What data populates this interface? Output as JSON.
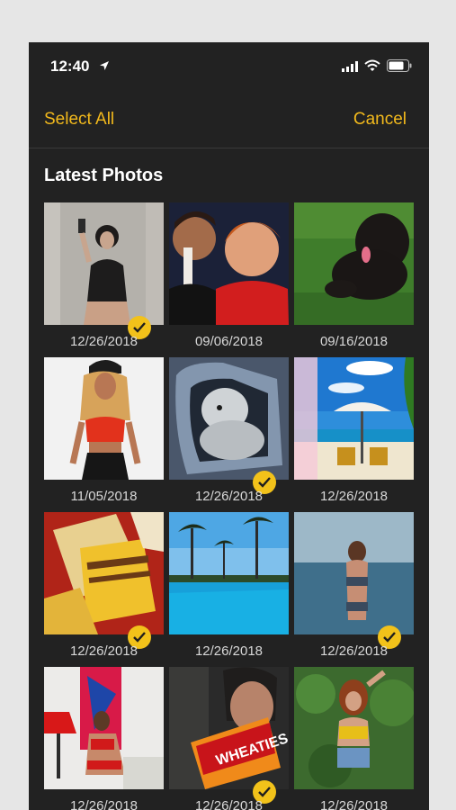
{
  "status_bar": {
    "time": "12:40",
    "location_icon": "location-arrow-icon",
    "signal_icon": "cellular-signal-icon",
    "wifi_icon": "wifi-icon",
    "battery_icon": "battery-icon",
    "battery_level": 0.8
  },
  "header": {
    "select_all_label": "Select All",
    "cancel_label": "Cancel",
    "accent_color": "#f2b91c"
  },
  "section": {
    "title": "Latest Photos"
  },
  "photos": [
    {
      "date": "12/26/2018",
      "selected": true
    },
    {
      "date": "09/06/2018",
      "selected": false
    },
    {
      "date": "09/16/2018",
      "selected": false
    },
    {
      "date": "11/05/2018",
      "selected": false
    },
    {
      "date": "12/26/2018",
      "selected": true
    },
    {
      "date": "12/26/2018",
      "selected": false
    },
    {
      "date": "12/26/2018",
      "selected": true
    },
    {
      "date": "12/26/2018",
      "selected": false
    },
    {
      "date": "12/26/2018",
      "selected": true
    },
    {
      "date": "12/26/2018",
      "selected": false
    },
    {
      "date": "12/26/2018",
      "selected": true
    },
    {
      "date": "12/26/2018",
      "selected": false
    }
  ]
}
